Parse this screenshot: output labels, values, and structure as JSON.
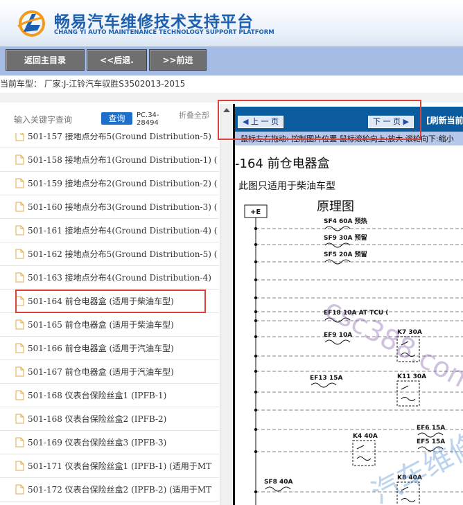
{
  "header": {
    "title_cn": "畅易汽车维修技术支持平台",
    "title_en": "CHANG YI AUTO MAINTENANCE TECHNOLOGY SUPPORT PLATFORM",
    "logo_icon": "cy-logo",
    "colors": {
      "brand_blue": "#1b5fae",
      "logo_orange": "#f29a1b"
    }
  },
  "nav": {
    "home_label": "返回主目录",
    "back_label": "<<后退.",
    "forward_label": ">>前进"
  },
  "current_model": "当前车型： 厂家:J-江铃汽车驭胜S3502013-2015",
  "search": {
    "placeholder": "输入关键字查询",
    "button_label": "查询",
    "code": "PC.34-28494",
    "collapse_label": "折叠全部"
  },
  "tree": {
    "items": [
      {
        "label": "501-157 接地点分布5(Ground Distribution-5)",
        "selected": false
      },
      {
        "label": "501-158 接地点分布1(Ground Distribution-1) (",
        "selected": false
      },
      {
        "label": "501-159 接地点分布2(Ground Distribution-2) (",
        "selected": false
      },
      {
        "label": "501-160 接地点分布3(Ground Distribution-3) (",
        "selected": false
      },
      {
        "label": "501-161 接地点分布4(Ground Distribution-4) (",
        "selected": false
      },
      {
        "label": "501-162 接地点分布5(Ground Distribution-5) (",
        "selected": false
      },
      {
        "label": "501-163 接地点分布4(Ground Distribution-4)",
        "selected": false
      },
      {
        "label": "501-164 前仓电器盒 (适用于柴油车型)",
        "selected": true
      },
      {
        "label": "501-165 前仓电器盒 (适用于柴油车型)",
        "selected": false
      },
      {
        "label": "501-166 前仓电器盒 (适用于汽油车型)",
        "selected": false
      },
      {
        "label": "501-167 前仓电器盒 (适用于汽油车型)",
        "selected": false
      },
      {
        "label": "501-168 仪表台保险丝盒1 (IPFB-1)",
        "selected": false
      },
      {
        "label": "501-168 仪表台保险丝盒2 (IPFB-2)",
        "selected": false
      },
      {
        "label": "501-169 仪表台保险丝盒3 (IPFB-3)",
        "selected": false
      },
      {
        "label": "501-171 仪表台保险丝盒1 (IPFB-1) (适用于MT",
        "selected": false
      },
      {
        "label": "501-172 仪表台保险丝盒2 (IPFB-2) (适用于MT",
        "selected": false
      }
    ]
  },
  "viewer": {
    "prev_label": "上 一 页",
    "next_label": "下 一 页",
    "refresh_label": "[刷新当前",
    "hint": "鼠标左右拖动: 控制图片位置 鼠标滚轮向上:放大   滚轮向下:缩小",
    "diagram_title": "-164 前仓电器盒",
    "diagram_subtitle": "此图只适用于柴油车型",
    "schematic_heading": "原理图",
    "plus_e": "+E",
    "fuses": [
      {
        "id": "SF4",
        "rating": "60A",
        "note": "预热"
      },
      {
        "id": "SF9",
        "rating": "30A",
        "note": "预留"
      },
      {
        "id": "SF5",
        "rating": "20A",
        "note": "预留"
      },
      {
        "id": "EF18",
        "rating": "10A",
        "note": "AT TCU ("
      },
      {
        "id": "EF9",
        "rating": "10A",
        "note": ""
      },
      {
        "id": "EF13",
        "rating": "15A",
        "note": ""
      },
      {
        "id": "EF6",
        "rating": "15A",
        "note": ""
      },
      {
        "id": "EF5",
        "rating": "15A",
        "note": ""
      },
      {
        "id": "SF8",
        "rating": "40A",
        "note": ""
      }
    ],
    "relays": [
      {
        "id": "K7",
        "rating": "30A"
      },
      {
        "id": "K11",
        "rating": "30A"
      },
      {
        "id": "K4",
        "rating": "40A"
      },
      {
        "id": "K8",
        "rating": "40A"
      }
    ],
    "watermark": "csc388.com 汽车维修"
  }
}
